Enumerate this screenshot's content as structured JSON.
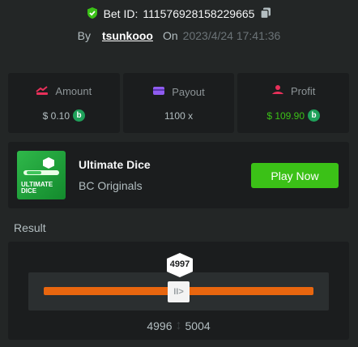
{
  "bet": {
    "id_label": "Bet ID:",
    "id_value": "111576928158229665",
    "by_label": "By",
    "username": "tsunkooo",
    "on_label": "On",
    "datetime": "2023/4/24 17:41:36"
  },
  "stats": {
    "amount": {
      "label": "Amount",
      "value": "$ 0.10"
    },
    "payout": {
      "label": "Payout",
      "value": "1100 x"
    },
    "profit": {
      "label": "Profit",
      "value": "$ 109.90"
    },
    "coin_glyph": "b"
  },
  "game": {
    "title": "Ultimate Dice",
    "subtitle": "BC Originals",
    "play_label": "Play Now",
    "thumb_text_1": "ULTIMATE",
    "thumb_text_2": "DICE"
  },
  "result": {
    "label": "Result",
    "value": "4997",
    "range_low": "4996",
    "range_high": "5004",
    "handle_glyph": "II>",
    "arrow_glyph": "↕"
  },
  "colors": {
    "accent_green": "#3bc117",
    "bar_orange": "#e8660f",
    "coin_green": "#1fa15a",
    "amount_icon": "#e8305a",
    "payout_icon": "#8f5cf0",
    "profit_icon": "#e8305a"
  }
}
